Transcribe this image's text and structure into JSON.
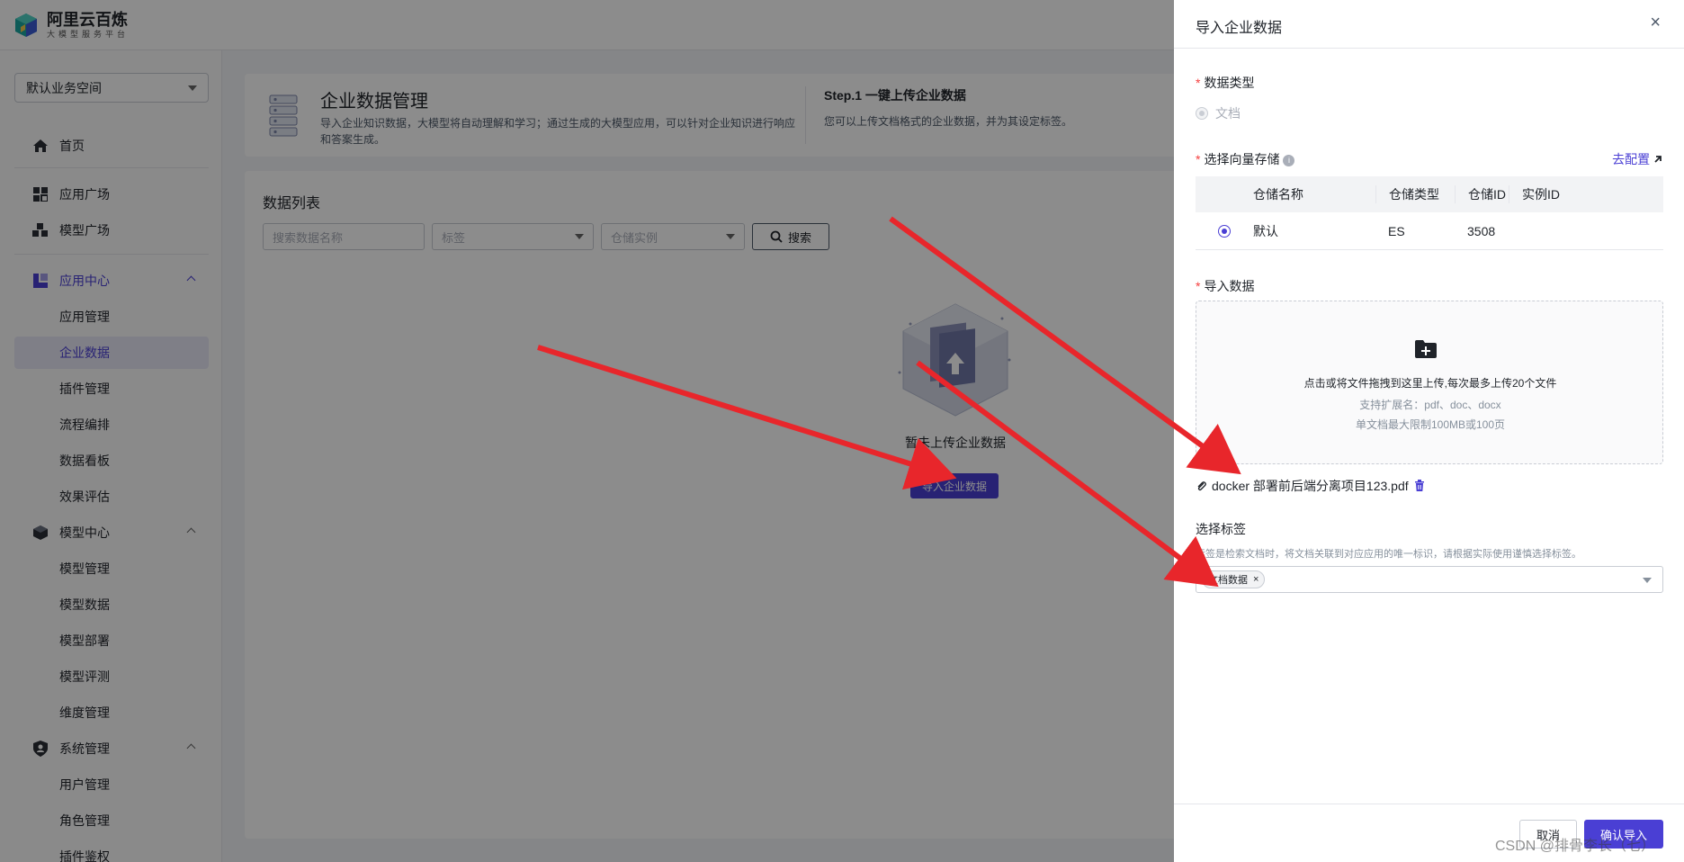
{
  "brand": {
    "title": "阿里云百炼",
    "subtitle": "大模型服务平台"
  },
  "sidebar": {
    "workspace": "默认业务空间",
    "items": [
      {
        "label": "首页"
      },
      {
        "label": "应用广场"
      },
      {
        "label": "模型广场"
      },
      {
        "label": "应用中心"
      },
      {
        "label": "应用管理"
      },
      {
        "label": "企业数据"
      },
      {
        "label": "插件管理"
      },
      {
        "label": "流程编排"
      },
      {
        "label": "数据看板"
      },
      {
        "label": "效果评估"
      },
      {
        "label": "模型中心"
      },
      {
        "label": "模型管理"
      },
      {
        "label": "模型数据"
      },
      {
        "label": "模型部署"
      },
      {
        "label": "模型评测"
      },
      {
        "label": "维度管理"
      },
      {
        "label": "系统管理"
      },
      {
        "label": "用户管理"
      },
      {
        "label": "角色管理"
      },
      {
        "label": "插件鉴权"
      }
    ]
  },
  "header_card": {
    "title": "企业数据管理",
    "description": "导入企业知识数据，大模型将自动理解和学习；通过生成的大模型应用，可以针对企业知识进行响应和答案生成。",
    "step_title": "Step.1 一键上传企业数据",
    "step_desc": "您可以上传文档格式的企业数据，并为其设定标签。"
  },
  "list": {
    "title": "数据列表",
    "search_placeholder": "搜索数据名称",
    "tag_placeholder": "标签",
    "store_placeholder": "仓储实例",
    "search_button": "搜索",
    "empty_text": "暂未上传企业数据",
    "import_button": "导入企业数据"
  },
  "drawer": {
    "title": "导入企业数据",
    "close": "×",
    "data_type_label": "数据类型",
    "data_type_option": "文档",
    "vector_label": "选择向量存储",
    "config_link": "去配置",
    "table": {
      "headers": [
        "仓储名称",
        "仓储类型",
        "仓储ID",
        "实例ID"
      ],
      "rows": [
        {
          "name": "默认",
          "type": "ES",
          "id": "3508",
          "instance": ""
        }
      ]
    },
    "import_label": "导入数据",
    "upload_main": "点击或将文件拖拽到这里上传,每次最多上传20个文件",
    "upload_ext": "支持扩展名：pdf、doc、docx",
    "upload_limit": "单文档最大限制100MB或100页",
    "file_name": "docker 部署前后端分离项目123.pdf",
    "tag_label": "选择标签",
    "tag_desc": "标签是检索文档时，将文档关联到对应应用的唯一标识，请根据实际使用谨慎选择标签。",
    "tag_chip": "文档数据",
    "cancel": "取消",
    "confirm": "确认导入"
  },
  "watermark": "CSDN @排骨李长（七）",
  "colors": {
    "accent": "#4a3fd4",
    "required": "#f53f3f",
    "arrow": "#e8262b"
  }
}
